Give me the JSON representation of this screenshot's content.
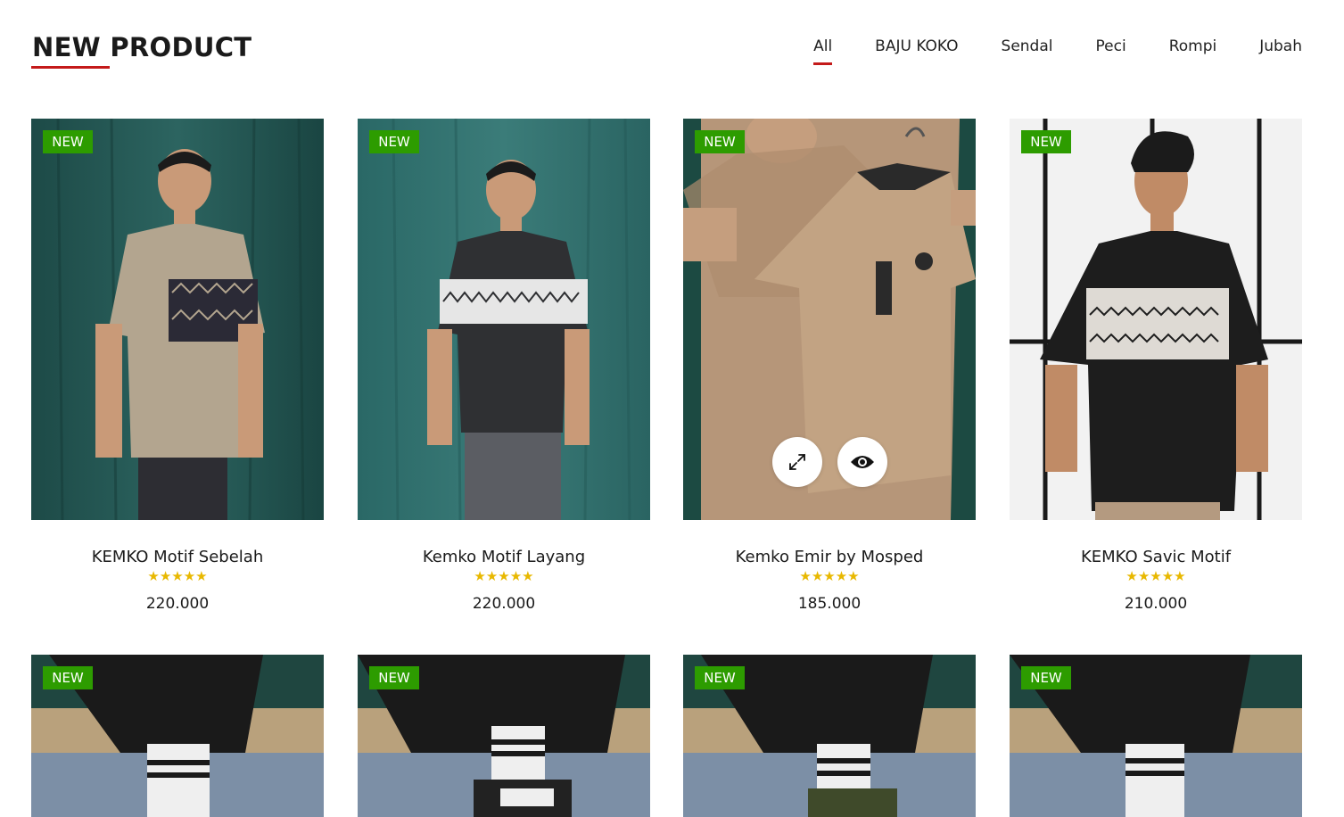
{
  "section": {
    "title": "NEW PRODUCT",
    "accent_color": "#c41a1a"
  },
  "tabs": [
    {
      "label": "All",
      "active": true
    },
    {
      "label": "BAJU KOKO",
      "active": false
    },
    {
      "label": "Sendal",
      "active": false
    },
    {
      "label": "Peci",
      "active": false
    },
    {
      "label": "Rompi",
      "active": false
    },
    {
      "label": "Jubah",
      "active": false
    }
  ],
  "badge_label": "NEW",
  "badge_color": "#2d9c00",
  "products": [
    {
      "name": "KEMKO Motif Sebelah",
      "rating": "★★★★★",
      "rating_value": 5,
      "price": "220.000"
    },
    {
      "name": "Kemko Motif Layang",
      "rating": "★★★★★",
      "rating_value": 5,
      "price": "220.000"
    },
    {
      "name": "Kemko Emir by Mosped",
      "rating": "★★★★★",
      "rating_value": 5,
      "price": "185.000"
    },
    {
      "name": "KEMKO Savic Motif",
      "rating": "★★★★★",
      "rating_value": 5,
      "price": "210.000"
    }
  ],
  "overlay": {
    "expand_icon": "expand-icon",
    "view_icon": "eye-icon"
  }
}
